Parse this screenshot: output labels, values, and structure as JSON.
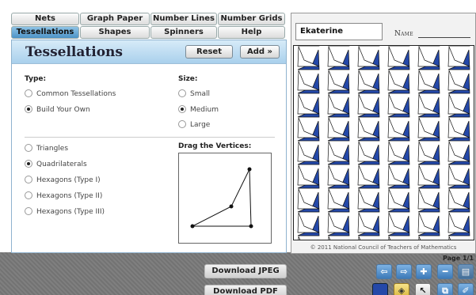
{
  "tabs": {
    "row1": [
      "Nets",
      "Graph Paper",
      "Number Lines",
      "Number Grids"
    ],
    "row2": [
      "Tessellations",
      "Shapes",
      "Spinners",
      "Help"
    ],
    "active": "Tessellations"
  },
  "panel": {
    "title": "Tessellations",
    "reset_label": "Reset",
    "add_label": "Add »",
    "type_label": "Type:",
    "type_options": [
      {
        "label": "Common Tessellations",
        "selected": false
      },
      {
        "label": "Build Your Own",
        "selected": true
      }
    ],
    "size_label": "Size:",
    "size_options": [
      {
        "label": "Small",
        "selected": false
      },
      {
        "label": "Medium",
        "selected": true
      },
      {
        "label": "Large",
        "selected": false
      }
    ],
    "shape_options": [
      {
        "label": "Triangles",
        "selected": false
      },
      {
        "label": "Quadrilaterals",
        "selected": true
      },
      {
        "label": "Hexagons (Type I)",
        "selected": false
      },
      {
        "label": "Hexagons (Type II)",
        "selected": false
      },
      {
        "label": "Hexagons (Type III)",
        "selected": false
      }
    ],
    "drag_label": "Drag the Vertices:"
  },
  "sheet": {
    "name_value": "Ekaterine",
    "name_label": "Name",
    "copyright": "© 2011 National Council of Teachers of Mathematics",
    "fill_color": "#2448a8"
  },
  "page_indicator": "Page 1/1",
  "downloads": {
    "jpeg": "Download JPEG",
    "pdf": "Download PDF"
  },
  "toolbar_icons": [
    "arrow-left-icon",
    "arrow-right-icon",
    "add-icon",
    "remove-icon",
    "page-icon",
    "color-swatch-icon",
    "paint-bucket-icon",
    "pointer-icon",
    "copy-icon",
    "eraser-icon"
  ]
}
